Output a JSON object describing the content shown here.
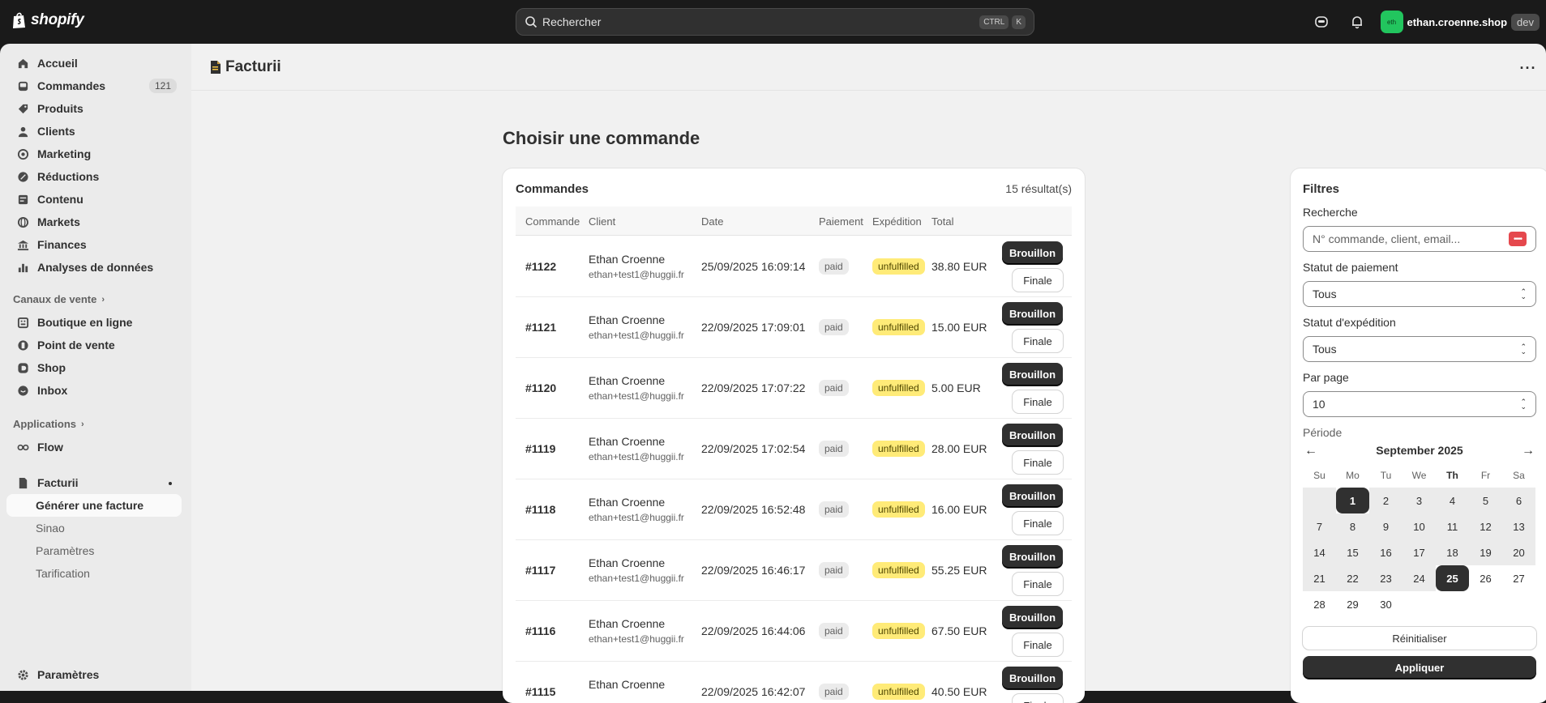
{
  "topbar": {
    "logo": "shopify",
    "search_placeholder": "Rechercher",
    "kbd1": "CTRL",
    "kbd2": "K",
    "store_initials": "eth",
    "store_name": "ethan.croenne.shop",
    "env": "dev"
  },
  "sidebar": {
    "items": [
      {
        "label": "Accueil",
        "icon": "home-icon"
      },
      {
        "label": "Commandes",
        "icon": "inbox-icon",
        "badge": "121"
      },
      {
        "label": "Produits",
        "icon": "tag-icon"
      },
      {
        "label": "Clients",
        "icon": "person-icon"
      },
      {
        "label": "Marketing",
        "icon": "target-icon"
      },
      {
        "label": "Réductions",
        "icon": "discount-icon"
      },
      {
        "label": "Contenu",
        "icon": "content-icon"
      },
      {
        "label": "Markets",
        "icon": "globe-icon"
      },
      {
        "label": "Finances",
        "icon": "bank-icon"
      },
      {
        "label": "Analyses de données",
        "icon": "chart-icon"
      }
    ],
    "sales_channels_label": "Canaux de vente",
    "channels": [
      {
        "label": "Boutique en ligne",
        "icon": "store-icon"
      },
      {
        "label": "Point de vente",
        "icon": "pos-icon"
      },
      {
        "label": "Shop",
        "icon": "shop-icon"
      },
      {
        "label": "Inbox",
        "icon": "inbox-chat-icon"
      }
    ],
    "apps_label": "Applications",
    "apps": [
      {
        "label": "Flow",
        "icon": "flow-icon"
      }
    ],
    "app_facturii": "Facturii",
    "facturii_sub": {
      "active": "Générer une facture",
      "items": [
        "Sinao",
        "Paramètres",
        "Tarification"
      ]
    },
    "settings": "Paramètres"
  },
  "page": {
    "title": "Facturii",
    "heading": "Choisir une commande"
  },
  "orders": {
    "title": "Commandes",
    "count": "15 résultat(s)",
    "headers": [
      "Commande",
      "Client",
      "Date",
      "Paiement",
      "Expédition",
      "Total"
    ],
    "draft_label": "Brouillon",
    "final_label": "Finale",
    "rows": [
      {
        "num": "#1122",
        "name": "Ethan Croenne",
        "email": "ethan+test1@huggii.fr",
        "date": "25/09/2025 16:09:14",
        "pay": "paid",
        "ship": "unfulfilled",
        "total": "38.80 EUR"
      },
      {
        "num": "#1121",
        "name": "Ethan Croenne",
        "email": "ethan+test1@huggii.fr",
        "date": "22/09/2025 17:09:01",
        "pay": "paid",
        "ship": "unfulfilled",
        "total": "15.00 EUR"
      },
      {
        "num": "#1120",
        "name": "Ethan Croenne",
        "email": "ethan+test1@huggii.fr",
        "date": "22/09/2025 17:07:22",
        "pay": "paid",
        "ship": "unfulfilled",
        "total": "5.00 EUR"
      },
      {
        "num": "#1119",
        "name": "Ethan Croenne",
        "email": "ethan+test1@huggii.fr",
        "date": "22/09/2025 17:02:54",
        "pay": "paid",
        "ship": "unfulfilled",
        "total": "28.00 EUR"
      },
      {
        "num": "#1118",
        "name": "Ethan Croenne",
        "email": "ethan+test1@huggii.fr",
        "date": "22/09/2025 16:52:48",
        "pay": "paid",
        "ship": "unfulfilled",
        "total": "16.00 EUR"
      },
      {
        "num": "#1117",
        "name": "Ethan Croenne",
        "email": "ethan+test1@huggii.fr",
        "date": "22/09/2025 16:46:17",
        "pay": "paid",
        "ship": "unfulfilled",
        "total": "55.25 EUR"
      },
      {
        "num": "#1116",
        "name": "Ethan Croenne",
        "email": "ethan+test1@huggii.fr",
        "date": "22/09/2025 16:44:06",
        "pay": "paid",
        "ship": "unfulfilled",
        "total": "67.50 EUR"
      },
      {
        "num": "#1115",
        "name": "Ethan Croenne",
        "email": "",
        "date": "22/09/2025 16:42:07",
        "pay": "paid",
        "ship": "unfulfilled",
        "total": "40.50 EUR"
      }
    ]
  },
  "filters": {
    "title": "Filtres",
    "search_label": "Recherche",
    "search_placeholder": "N° commande, client, email...",
    "payment_label": "Statut de paiement",
    "payment_value": "Tous",
    "shipping_label": "Statut d'expédition",
    "shipping_value": "Tous",
    "perpage_label": "Par page",
    "perpage_value": "10",
    "period_label": "Période",
    "calendar": {
      "month": "September 2025",
      "weekdays": [
        "Su",
        "Mo",
        "Tu",
        "We",
        "Th",
        "Fr",
        "Sa"
      ],
      "days": [
        "1",
        "2",
        "3",
        "4",
        "5",
        "6",
        "7",
        "8",
        "9",
        "10",
        "11",
        "12",
        "13",
        "14",
        "15",
        "16",
        "17",
        "18",
        "19",
        "20",
        "21",
        "22",
        "23",
        "24",
        "25",
        "26",
        "27",
        "28",
        "29",
        "30"
      ],
      "selected_start": "1",
      "selected_end": "25"
    },
    "reset_label": "Réinitialiser",
    "apply_label": "Appliquer"
  }
}
